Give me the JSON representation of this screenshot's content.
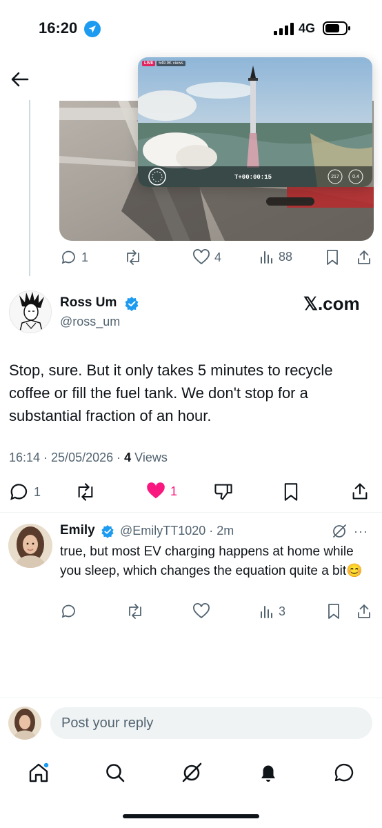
{
  "status_bar": {
    "time": "16:20",
    "network": "4G"
  },
  "parent_media": {
    "live_label": "LIVE",
    "views_label": "549.9K views",
    "timer": "T+00:00:15",
    "speed": "217",
    "altitude": "0.4"
  },
  "parent_actions": {
    "replies": "1",
    "likes": "4",
    "views": "88"
  },
  "tweet": {
    "author_name": "Ross Um",
    "author_handle": "@ross_um",
    "source_link": "𝕏.com",
    "text": "Stop, sure.  But it only takes 5 minutes to recycle coffee or fill the fuel tank.   We don't stop for a substantial fraction of an hour.",
    "timestamp": "16:14 · 25/05/2026 · ",
    "views_count": "4",
    "views_label": " Views",
    "replies": "1",
    "likes": "1",
    "like_color": "#f91880"
  },
  "reply": {
    "author_name": "Emily",
    "author_handle": "@EmilyTT1020 · 2m",
    "text": "true, but most EV charging happens at home while you sleep, which changes the equation quite a bit😊",
    "views": "3",
    "more_label": "···"
  },
  "compose": {
    "placeholder": "Post your reply"
  },
  "colors": {
    "verified": "#1d9bf0",
    "text_secondary": "#536471",
    "accent": "#1d9bf0"
  }
}
